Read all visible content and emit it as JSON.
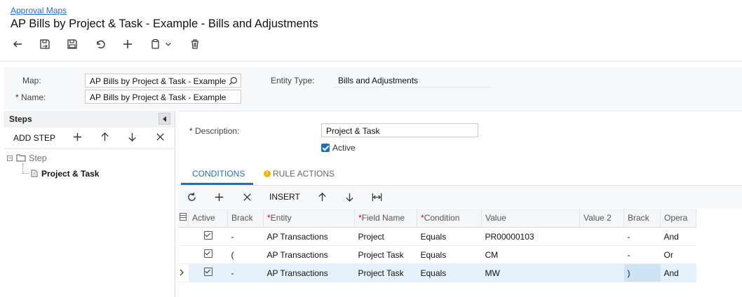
{
  "breadcrumb": "Approval Maps",
  "page_title": "AP Bills by Project & Task - Example - Bills and Adjustments",
  "toolbar": {
    "icons": [
      "back-icon",
      "save-close-icon",
      "save-icon",
      "undo-icon",
      "add-icon",
      "copy-paste-icon",
      "delete-icon"
    ]
  },
  "form": {
    "map_label": "Map:",
    "map_value": "AP Bills by Project & Task - Example",
    "name_label": "Name:",
    "name_value": "AP Bills by Project & Task - Example",
    "entity_type_label": "Entity Type:",
    "entity_type_value": "Bills and Adjustments"
  },
  "steps": {
    "title": "Steps",
    "add_step": "ADD STEP",
    "tree_root": "Step",
    "tree_child": "Project & Task"
  },
  "detail": {
    "description_label": "Description:",
    "description_value": "Project & Task",
    "active_label": "Active"
  },
  "tabs": {
    "conditions": "CONDITIONS",
    "rule_actions": "RULE ACTIONS"
  },
  "grid_toolbar": {
    "insert": "INSERT"
  },
  "grid": {
    "headers": {
      "active": "Active",
      "brack_open": "Brack",
      "entity": "Entity",
      "field_name": "Field Name",
      "condition": "Condition",
      "value": "Value",
      "value2": "Value 2",
      "brack_close": "Brack",
      "operator": "Opera"
    },
    "rows": [
      {
        "brack_open": "-",
        "entity": "AP Transactions",
        "field_name": "Project",
        "condition": "Equals",
        "value": "PR00000103",
        "value2": "",
        "brack_close": "-",
        "operator": "And"
      },
      {
        "brack_open": "(",
        "entity": "AP Transactions",
        "field_name": "Project Task",
        "condition": "Equals",
        "value": "CM",
        "value2": "",
        "brack_close": "-",
        "operator": "Or"
      },
      {
        "brack_open": "-",
        "entity": "AP Transactions",
        "field_name": "Project Task",
        "condition": "Equals",
        "value": "MW",
        "value2": "",
        "brack_close": ")",
        "operator": "And"
      }
    ]
  },
  "colors": {
    "accent": "#1f6fbf",
    "selected_row": "#e5f1fb",
    "warning": "#f0b400"
  }
}
